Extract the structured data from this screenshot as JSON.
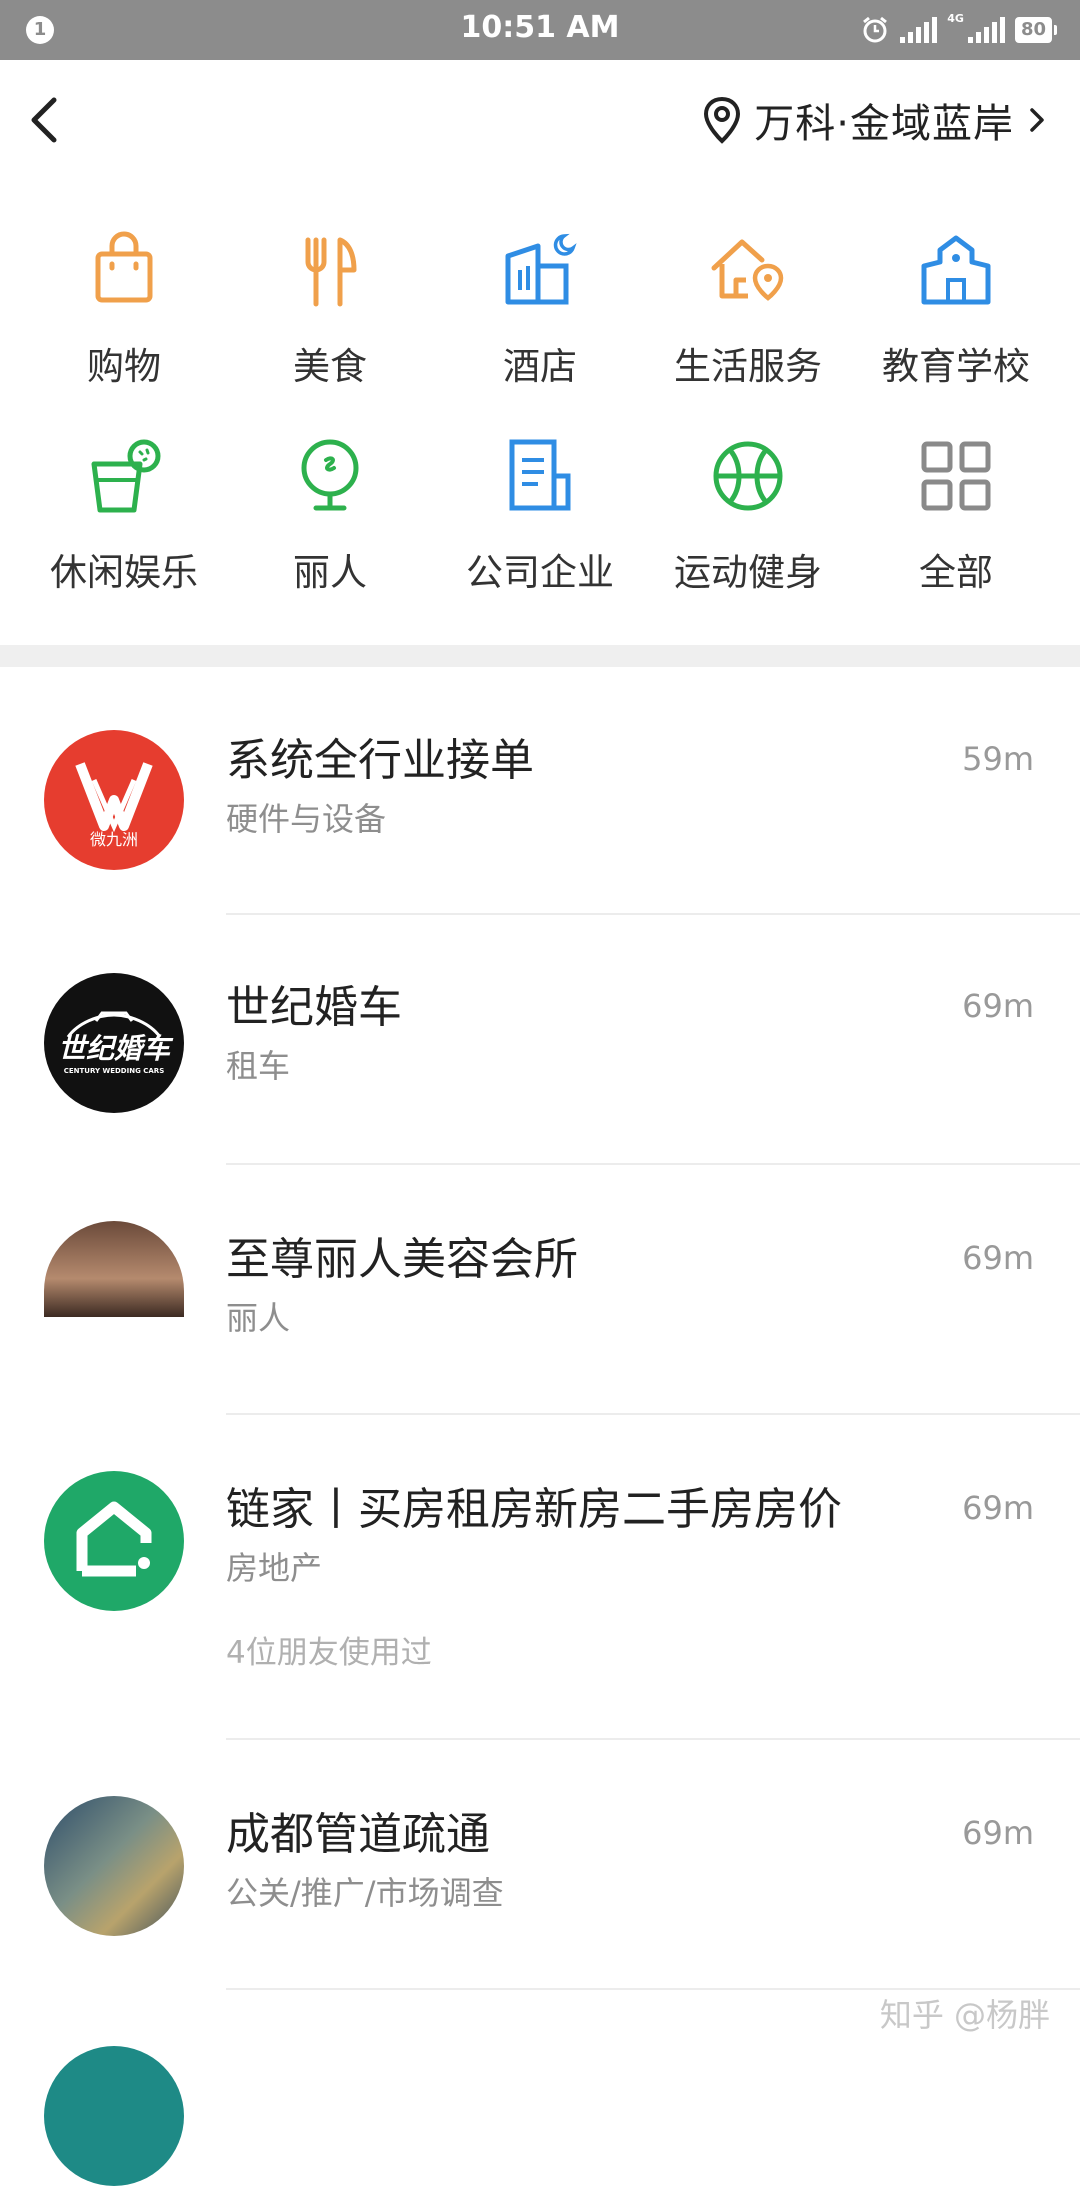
{
  "status_bar": {
    "notification_count": "1",
    "time": "10:51 AM",
    "network_label": "4G",
    "battery": "80",
    "icons": [
      "alarm-icon",
      "signal-icon",
      "signal-4g-icon",
      "battery-icon"
    ]
  },
  "header": {
    "back_icon": "chevron-left-icon",
    "location_icon": "map-pin-icon",
    "location": "万科·金域蓝岸",
    "location_chevron": "chevron-right-icon"
  },
  "categories": [
    {
      "label": "购物",
      "icon": "shopping-bag-icon",
      "color": "#f0a04b"
    },
    {
      "label": "美食",
      "icon": "fork-knife-icon",
      "color": "#f0a04b"
    },
    {
      "label": "酒店",
      "icon": "hotel-icon",
      "color": "#2f8de4"
    },
    {
      "label": "生活服务",
      "icon": "home-pin-icon",
      "color": "#f0a04b"
    },
    {
      "label": "教育学校",
      "icon": "school-icon",
      "color": "#2f8de4"
    },
    {
      "label": "休闲娱乐",
      "icon": "drink-icon",
      "color": "#2db14d"
    },
    {
      "label": "丽人",
      "icon": "mirror-icon",
      "color": "#2db14d"
    },
    {
      "label": "公司企业",
      "icon": "building-doc-icon",
      "color": "#2f8de4"
    },
    {
      "label": "运动健身",
      "icon": "ball-icon",
      "color": "#2db14d"
    },
    {
      "label": "全部",
      "icon": "grid-icon",
      "color": "#8a8a8a"
    }
  ],
  "places": [
    {
      "title": "系统全行业接单",
      "category": "硬件与设备",
      "distance": "59m",
      "extra": "",
      "avatar_text": "微九洲"
    },
    {
      "title": "世纪婚车",
      "category": "租车",
      "distance": "69m",
      "extra": "",
      "avatar_text": "世纪婚车",
      "avatar_subtext": "CENTURY WEDDING CARS"
    },
    {
      "title": "至尊丽人美容会所",
      "category": "丽人",
      "distance": "69m",
      "extra": "",
      "avatar_text": ""
    },
    {
      "title": "链家丨买房租房新房二手房房价",
      "category": "房地产",
      "distance": "69m",
      "extra": "4位朋友使用过",
      "avatar_text": ""
    },
    {
      "title": "成都管道疏通",
      "category": "公关/推广/市场调查",
      "distance": "69m",
      "extra": "",
      "avatar_text": ""
    }
  ],
  "watermark": "知乎 @杨胖"
}
